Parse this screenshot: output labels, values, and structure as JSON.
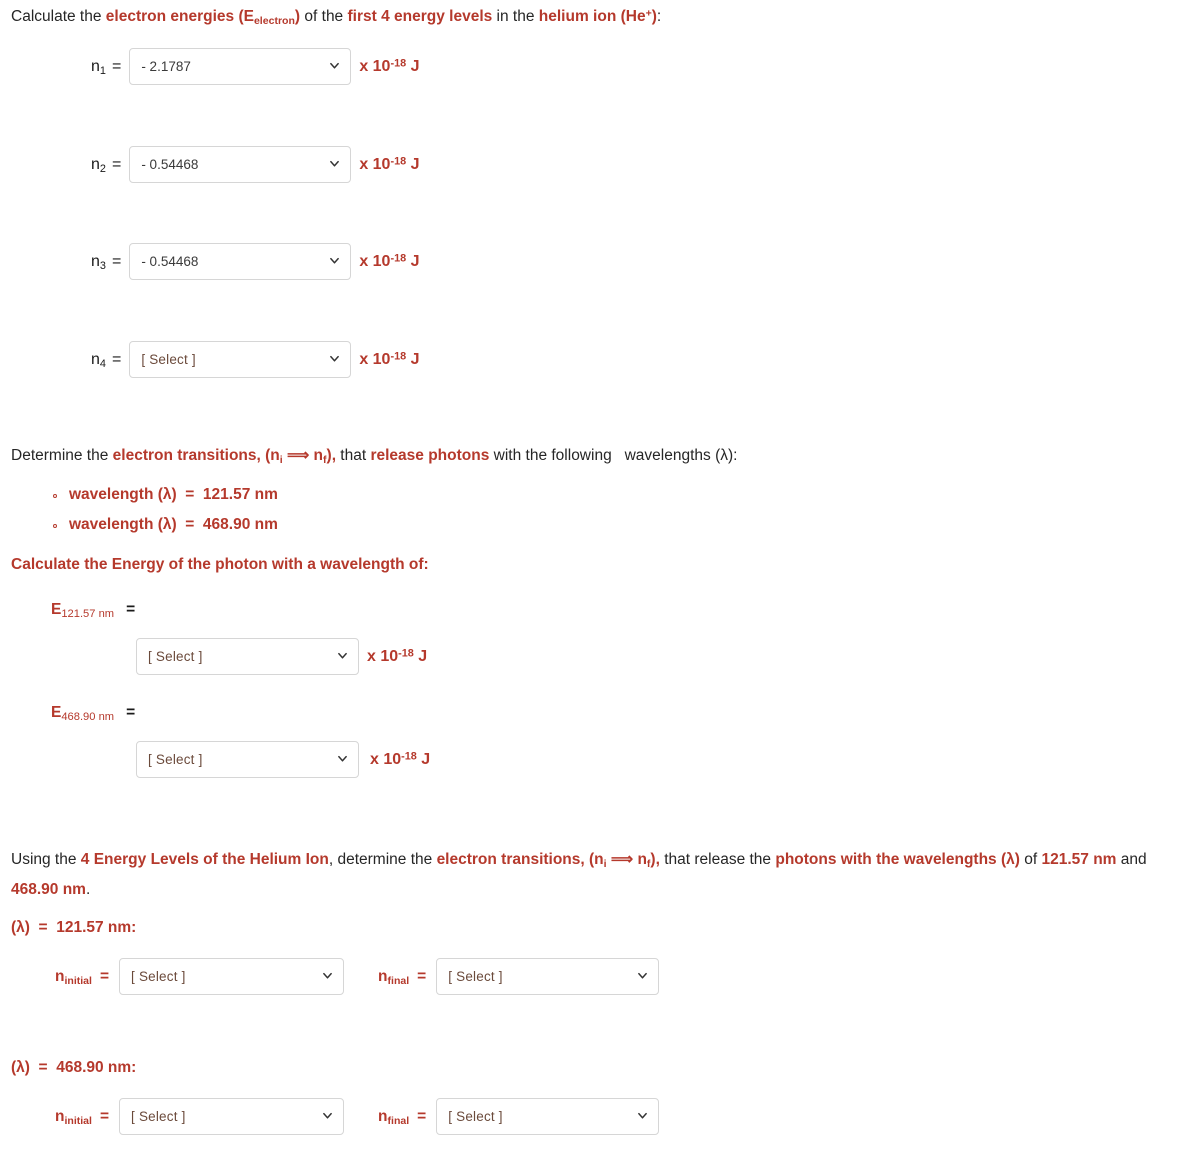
{
  "prompt": {
    "pre": "Calculate the ",
    "bold1": "electron energies (E",
    "bold1sub": "electron",
    "bold1end": ")",
    "mid": " of the ",
    "bold2": "first 4 energy levels",
    "mid2": " in the ",
    "bold3": "helium ion (He",
    "bold3sup": "+",
    "bold3end": ")",
    "end": ":"
  },
  "energy_levels": [
    {
      "label_n": "n",
      "label_sub": "1",
      "eq": "=",
      "value": "- 2.1787",
      "is_placeholder": false,
      "units_x": "x 10",
      "units_exp": "-18",
      "units_j": " J"
    },
    {
      "label_n": "n",
      "label_sub": "2",
      "eq": "=",
      "value": "- 0.54468",
      "is_placeholder": false,
      "units_x": "x 10",
      "units_exp": "-18",
      "units_j": " J"
    },
    {
      "label_n": "n",
      "label_sub": "3",
      "eq": "=",
      "value": "- 0.54468",
      "is_placeholder": false,
      "units_x": "x 10",
      "units_exp": "-18",
      "units_j": " J"
    },
    {
      "label_n": "n",
      "label_sub": "4",
      "eq": "=",
      "value": "[ Select ]",
      "is_placeholder": true,
      "units_x": "x 10",
      "units_exp": "-18",
      "units_j": " J"
    }
  ],
  "determine": {
    "pre": "Determine the ",
    "bold1": "electron transitions, (n",
    "bold1sub": "i",
    "arrow": " ⟹ ",
    "bold1b": "n",
    "bold1bsub": "f",
    "bold1end": "),",
    "mid": " that ",
    "bold2": "release photons",
    "end": " with the following   wavelengths (λ):"
  },
  "wavelength_bullets": [
    "wavelength (λ)  =  121.57 nm",
    "wavelength (λ)  =  468.90 nm"
  ],
  "energy_heading": "Calculate the Energy of the photon with a wavelength of:",
  "photon_energies": [
    {
      "e_label": "E",
      "e_sub": "121.57 nm",
      "eq": "=",
      "value": "[ Select ]",
      "is_placeholder": true,
      "units_x": "x 10",
      "units_exp": "-18",
      "units_j": " J"
    },
    {
      "e_label": "E",
      "e_sub": "468.90 nm",
      "eq": "=",
      "value": "[ Select ]",
      "is_placeholder": true,
      "units_x": "x 10",
      "units_exp": "-18",
      "units_j": " J"
    }
  ],
  "using_para": {
    "p1": "Using the ",
    "b1": "4 Energy Levels of the Helium Ion",
    "p2": ", determine the ",
    "b2": "electron transitions, (n",
    "b2sub": "i",
    "arrow": " ⟹ ",
    "b2b": "n",
    "b2bsub": "f",
    "b2end": "),",
    "p3": " that release the ",
    "b3": "photons with the wavelengths (λ)",
    "p4": " of ",
    "b4": "121.57 nm",
    "p5": " and ",
    "b5": "468.90 nm",
    "p6": "."
  },
  "transitions": [
    {
      "heading": "(λ)  =  121.57 nm:",
      "initial_label_n": "n",
      "initial_label_sub": "initial",
      "initial_eq": "=",
      "initial_value": "[ Select ]",
      "final_label_n": "n",
      "final_label_sub": "final",
      "final_eq": "=",
      "final_value": "[ Select ]"
    },
    {
      "heading": "(λ)  =  468.90 nm:",
      "initial_label_n": "n",
      "initial_label_sub": "initial",
      "initial_eq": "=",
      "initial_value": "[ Select ]",
      "final_label_n": "n",
      "final_label_sub": "final",
      "final_eq": "=",
      "final_value": "[ Select ]"
    }
  ],
  "icons": {
    "chevron": "chevron-down-icon"
  },
  "colors": {
    "accent_red": "#b5392c",
    "text": "#262626",
    "select_border": "#d6d6d6",
    "placeholder": "#6b4a3b"
  }
}
